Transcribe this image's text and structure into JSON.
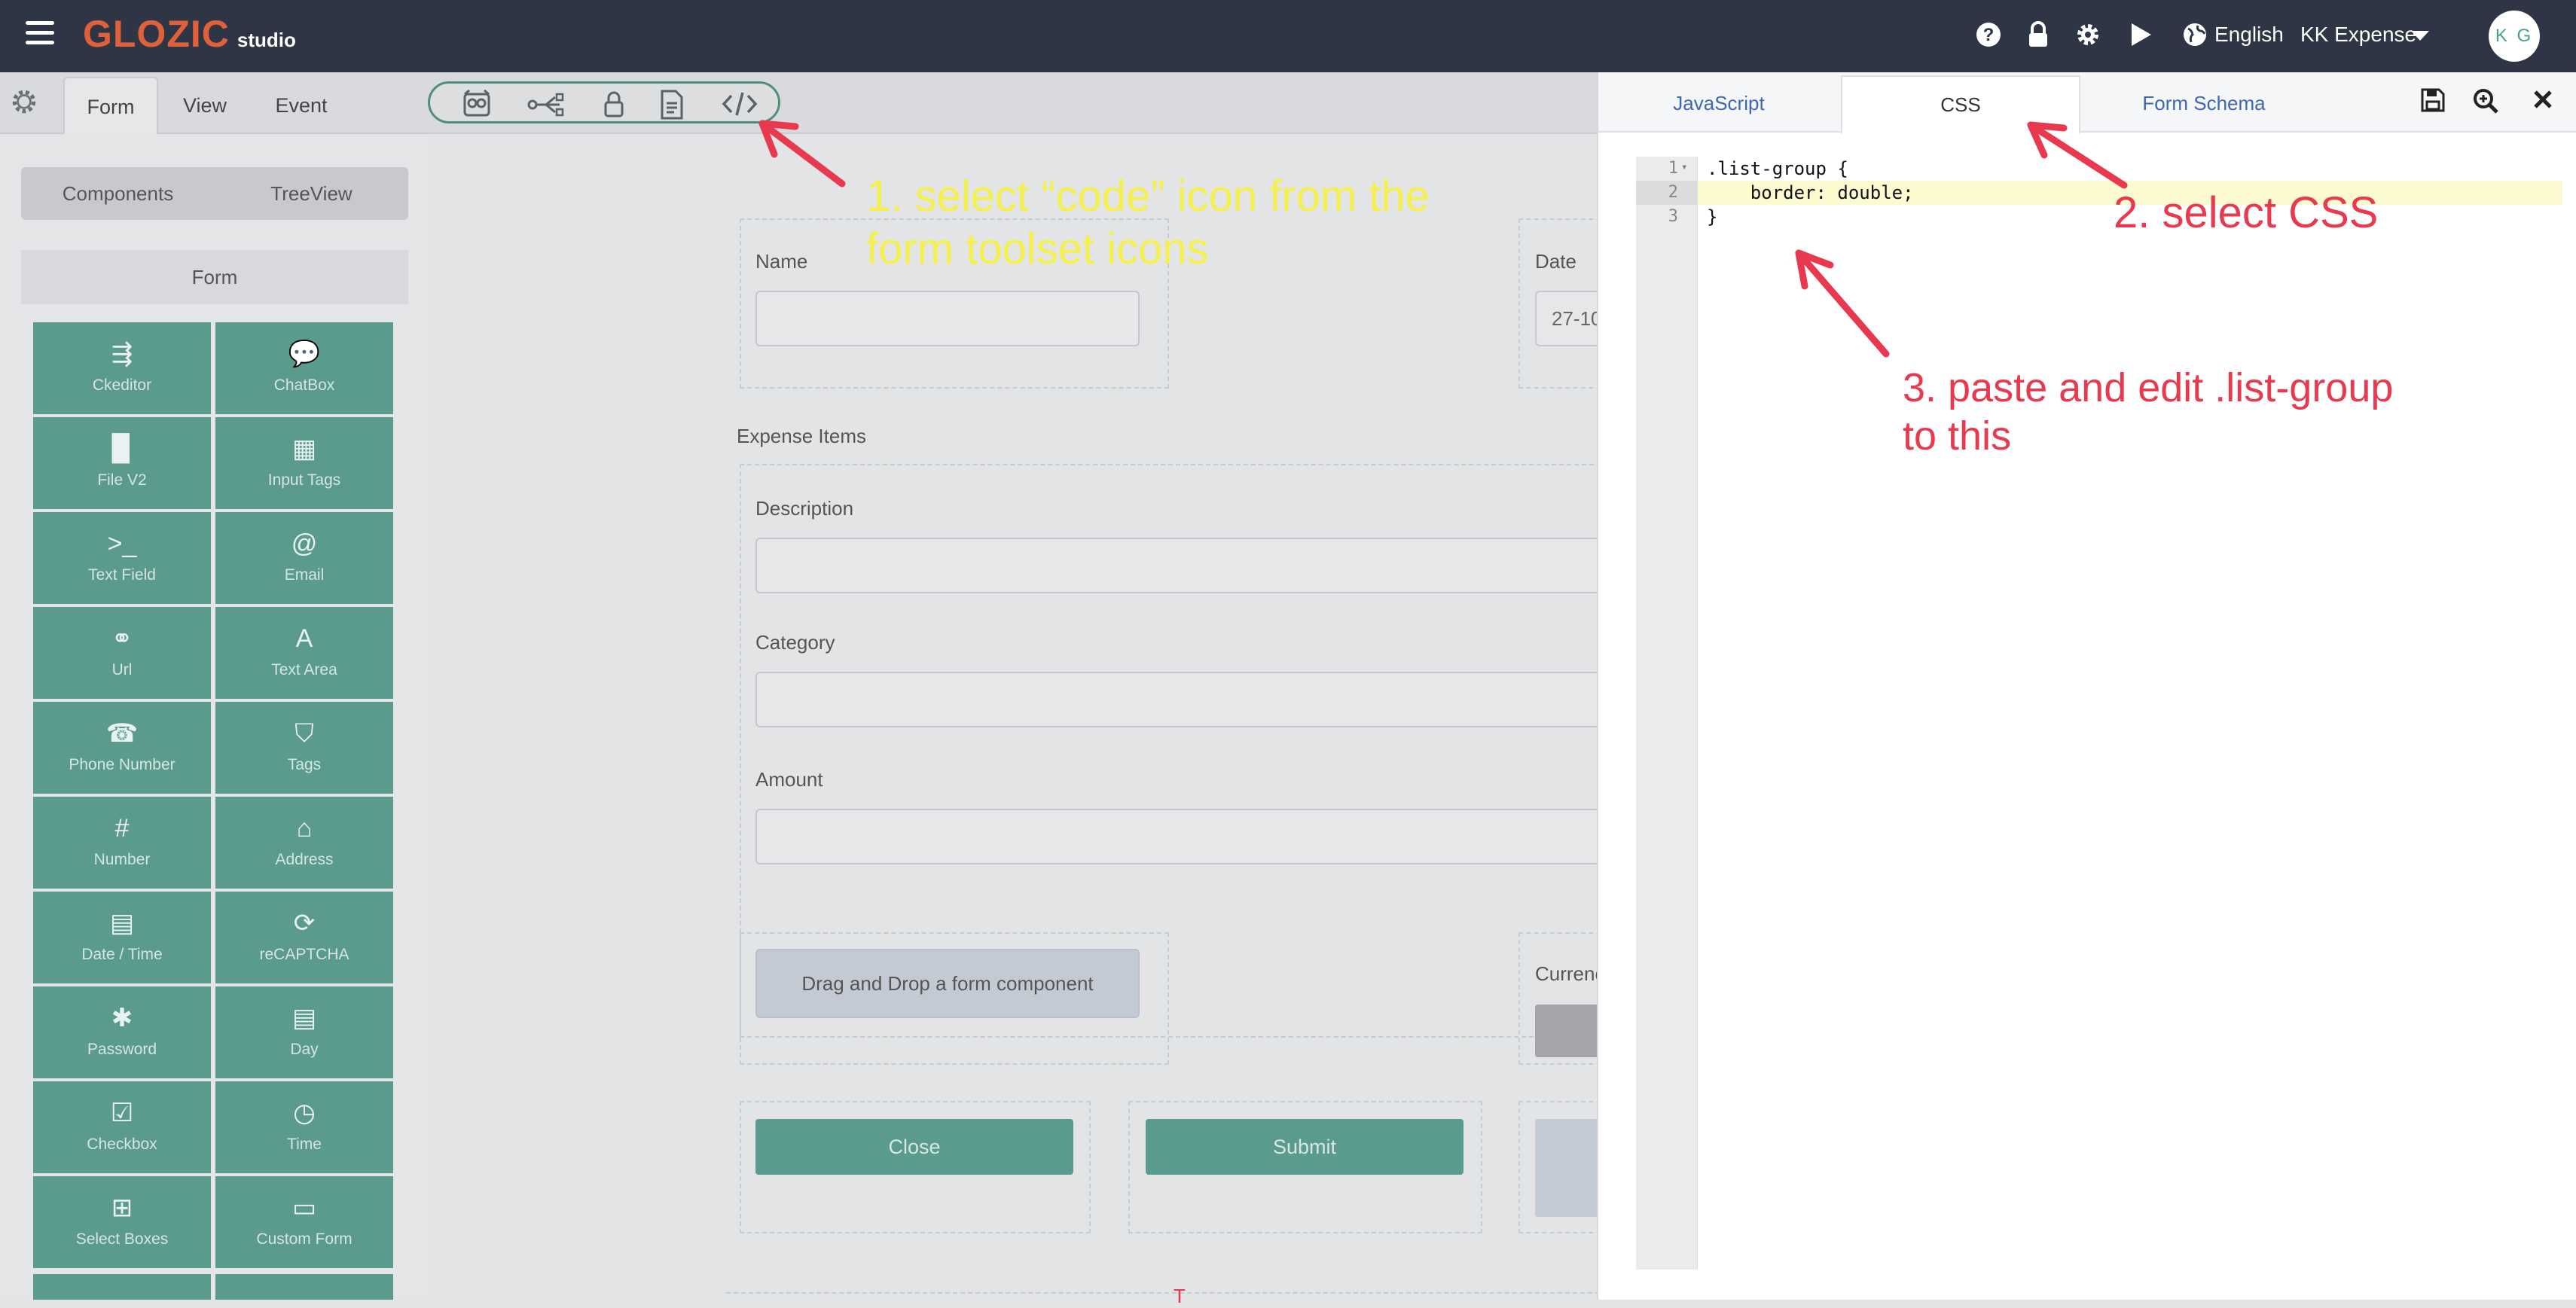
{
  "colors": {
    "topbar_bg": "#2e3645",
    "brand": "#e0603a",
    "component_tile": "#5b9b8e",
    "annotation_yellow": "#f5f04a",
    "annotation_red": "#e8394f",
    "link_blue": "#3f67b0"
  },
  "topbar": {
    "logo_main": "GLOZIC",
    "logo_sub": "studio",
    "icons": [
      "menu-icon",
      "help-icon",
      "lock-icon",
      "settings-icon",
      "play-icon",
      "globe-icon",
      "caret-down-icon"
    ],
    "language": "English",
    "project": "KK Expense",
    "avatar_initials": "K G"
  },
  "builder_tabs": [
    "Form",
    "View",
    "Event"
  ],
  "toolset_icons": [
    "owl-icon",
    "flow-icon",
    "lock-icon",
    "document-icon",
    "code-icon"
  ],
  "left_panel": {
    "seg_components": "Components",
    "seg_treeview": "TreeView",
    "group_header": "Form",
    "components": [
      {
        "label": "Ckeditor",
        "icon": "⇶"
      },
      {
        "label": "ChatBox",
        "icon": "💬"
      },
      {
        "label": "File V2",
        "icon": "▉"
      },
      {
        "label": "Input Tags",
        "icon": "▦"
      },
      {
        "label": "Text Field",
        "icon": ">_"
      },
      {
        "label": "Email",
        "icon": "@"
      },
      {
        "label": "Url",
        "icon": "⚭"
      },
      {
        "label": "Text Area",
        "icon": "A"
      },
      {
        "label": "Phone Number",
        "icon": "☎"
      },
      {
        "label": "Tags",
        "icon": "⛉"
      },
      {
        "label": "Number",
        "icon": "#"
      },
      {
        "label": "Address",
        "icon": "⌂"
      },
      {
        "label": "Date / Time",
        "icon": "▤"
      },
      {
        "label": "reCAPTCHA",
        "icon": "⟳"
      },
      {
        "label": "Password",
        "icon": "✱"
      },
      {
        "label": "Day",
        "icon": "▤"
      },
      {
        "label": "Checkbox",
        "icon": "☑"
      },
      {
        "label": "Time",
        "icon": "◷"
      },
      {
        "label": "Select Boxes",
        "icon": "⊞"
      },
      {
        "label": "Custom Form",
        "icon": "▭"
      }
    ]
  },
  "form": {
    "name_label": "Name",
    "date_label": "Date",
    "date_value": "27-10",
    "section_title": "Expense Items",
    "description_label": "Description",
    "category_label": "Category",
    "amount_label": "Amount",
    "dropzone_text": "Drag and Drop a form component",
    "currency_label": "Currenc",
    "close_button": "Close",
    "submit_button": "Submit"
  },
  "right_panel": {
    "tabs": [
      "JavaScript",
      "CSS",
      "Form Schema"
    ],
    "active_tab": "CSS",
    "icons": [
      "save-icon",
      "zoom-icon",
      "close-icon"
    ],
    "line_numbers": [
      "1",
      "2",
      "3"
    ],
    "code_lines": [
      ".list-group {",
      "    border: double;",
      "}"
    ]
  },
  "annotations": {
    "step1_line1": "1. select “code” icon from the",
    "step1_line2": "form toolset icons",
    "step2": "2. select CSS",
    "step3_line1": "3. paste and edit .list-group",
    "step3_line2": "to this"
  }
}
